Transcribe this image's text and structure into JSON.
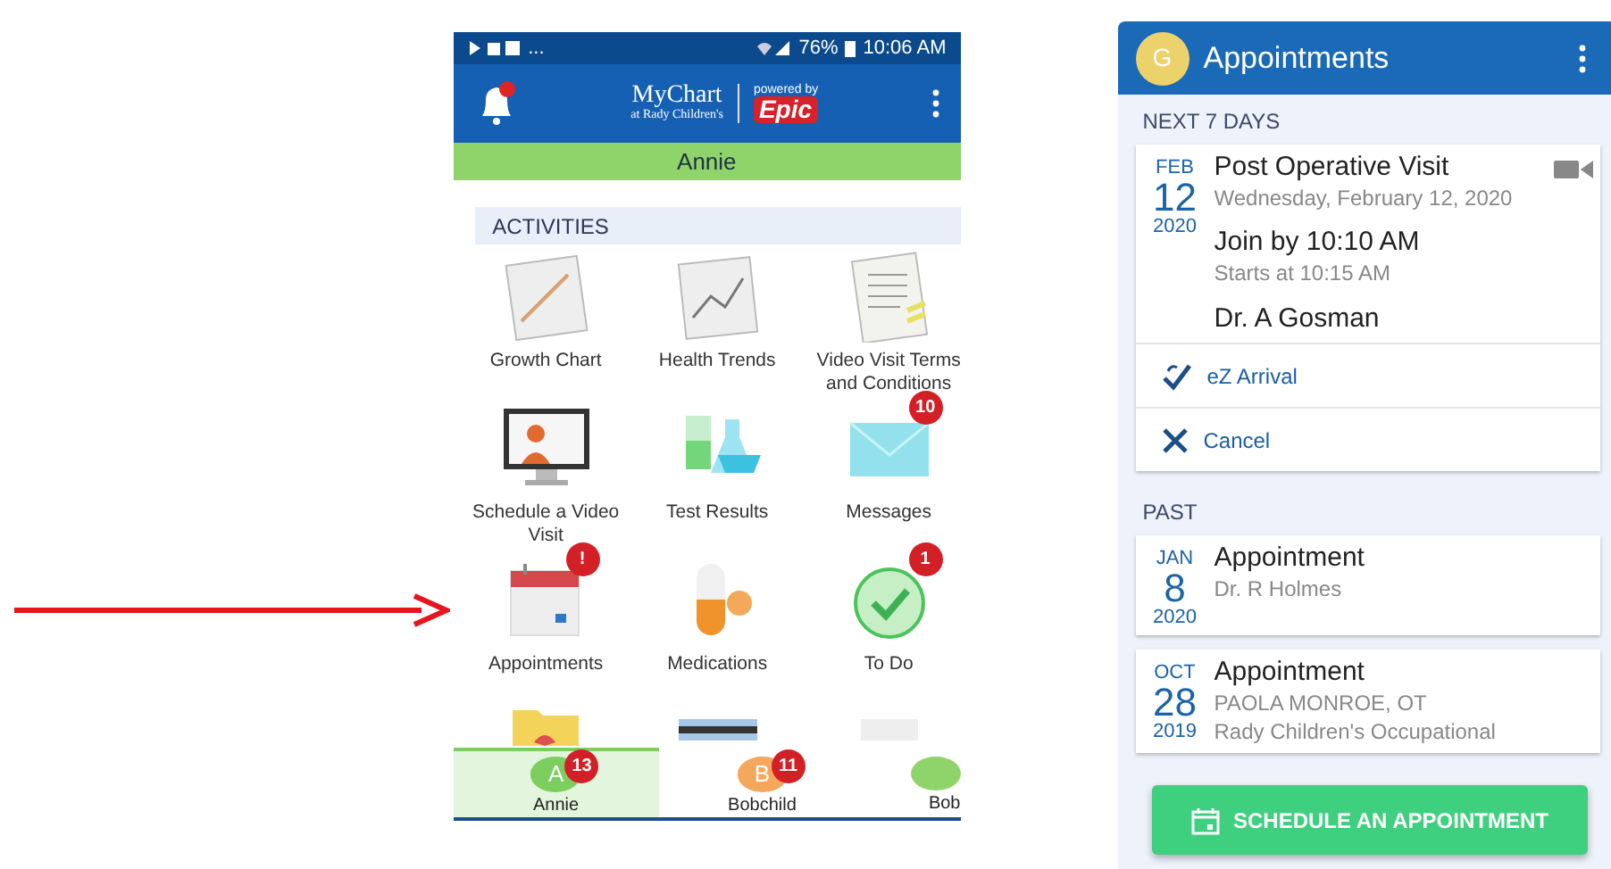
{
  "left_phone": {
    "status_bar": {
      "notifications": "...",
      "battery": "76%",
      "time": "10:06 AM"
    },
    "header": {
      "logo_text": "MyChart",
      "logo_subtext": "at Rady Children's",
      "powered_by": "powered by",
      "brand": "Epic",
      "bell_alert": true
    },
    "patient_bar": "Annie",
    "section_title": "ACTIVITIES",
    "activities": [
      {
        "kind": "growth-chart",
        "label": "Growth Chart"
      },
      {
        "kind": "trends",
        "label": "Health Trends"
      },
      {
        "kind": "document",
        "label": "Video Visit Terms and Conditions"
      },
      {
        "kind": "video",
        "label": "Schedule a Video Visit"
      },
      {
        "kind": "lab",
        "label": "Test Results"
      },
      {
        "kind": "mail",
        "label": "Messages",
        "badge": "10"
      },
      {
        "kind": "calendar",
        "label": "Appointments",
        "badge": "!"
      },
      {
        "kind": "pills",
        "label": "Medications"
      },
      {
        "kind": "check",
        "label": "To Do",
        "badge": "1"
      },
      {
        "kind": "folder"
      },
      {
        "kind": "card"
      },
      {
        "kind": "paper"
      }
    ],
    "proxies": [
      {
        "initial": "A",
        "name": "Annie",
        "badge": "13",
        "selected": true,
        "color": "#7ccf5e"
      },
      {
        "initial": "B",
        "name": "Bobchild",
        "badge": "11",
        "selected": false,
        "color": "#f5a75c"
      },
      {
        "name": "Bob",
        "selected": false,
        "color": "#8fd46a"
      }
    ]
  },
  "right_phone": {
    "header": {
      "avatar_initial": "G",
      "title": "Appointments"
    },
    "sections": [
      {
        "title": "NEXT 7 DAYS",
        "appointments": [
          {
            "month": "FEB",
            "day": "12",
            "year": "2020",
            "title": "Post Operative Visit",
            "lines": [
              "Wednesday, February 12, 2020"
            ],
            "join": "Join by 10:10 AM",
            "starts": "Starts at 10:15 AM",
            "provider": "Dr. A Gosman",
            "video": true,
            "actions": [
              {
                "kind": "ez-arrival",
                "label": "eZ Arrival"
              },
              {
                "kind": "cancel",
                "label": "Cancel"
              }
            ]
          }
        ]
      },
      {
        "title": "PAST",
        "appointments": [
          {
            "month": "JAN",
            "day": "8",
            "year": "2020",
            "title": "Appointment",
            "lines": [
              "Dr. R Holmes"
            ],
            "video": false
          },
          {
            "month": "OCT",
            "day": "28",
            "year": "2019",
            "title": "Appointment",
            "lines": [
              "PAOLA MONROE, OT",
              "Rady Children's Occupational"
            ],
            "video": false
          }
        ]
      }
    ],
    "schedule_button": "SCHEDULE AN APPOINTMENT"
  }
}
